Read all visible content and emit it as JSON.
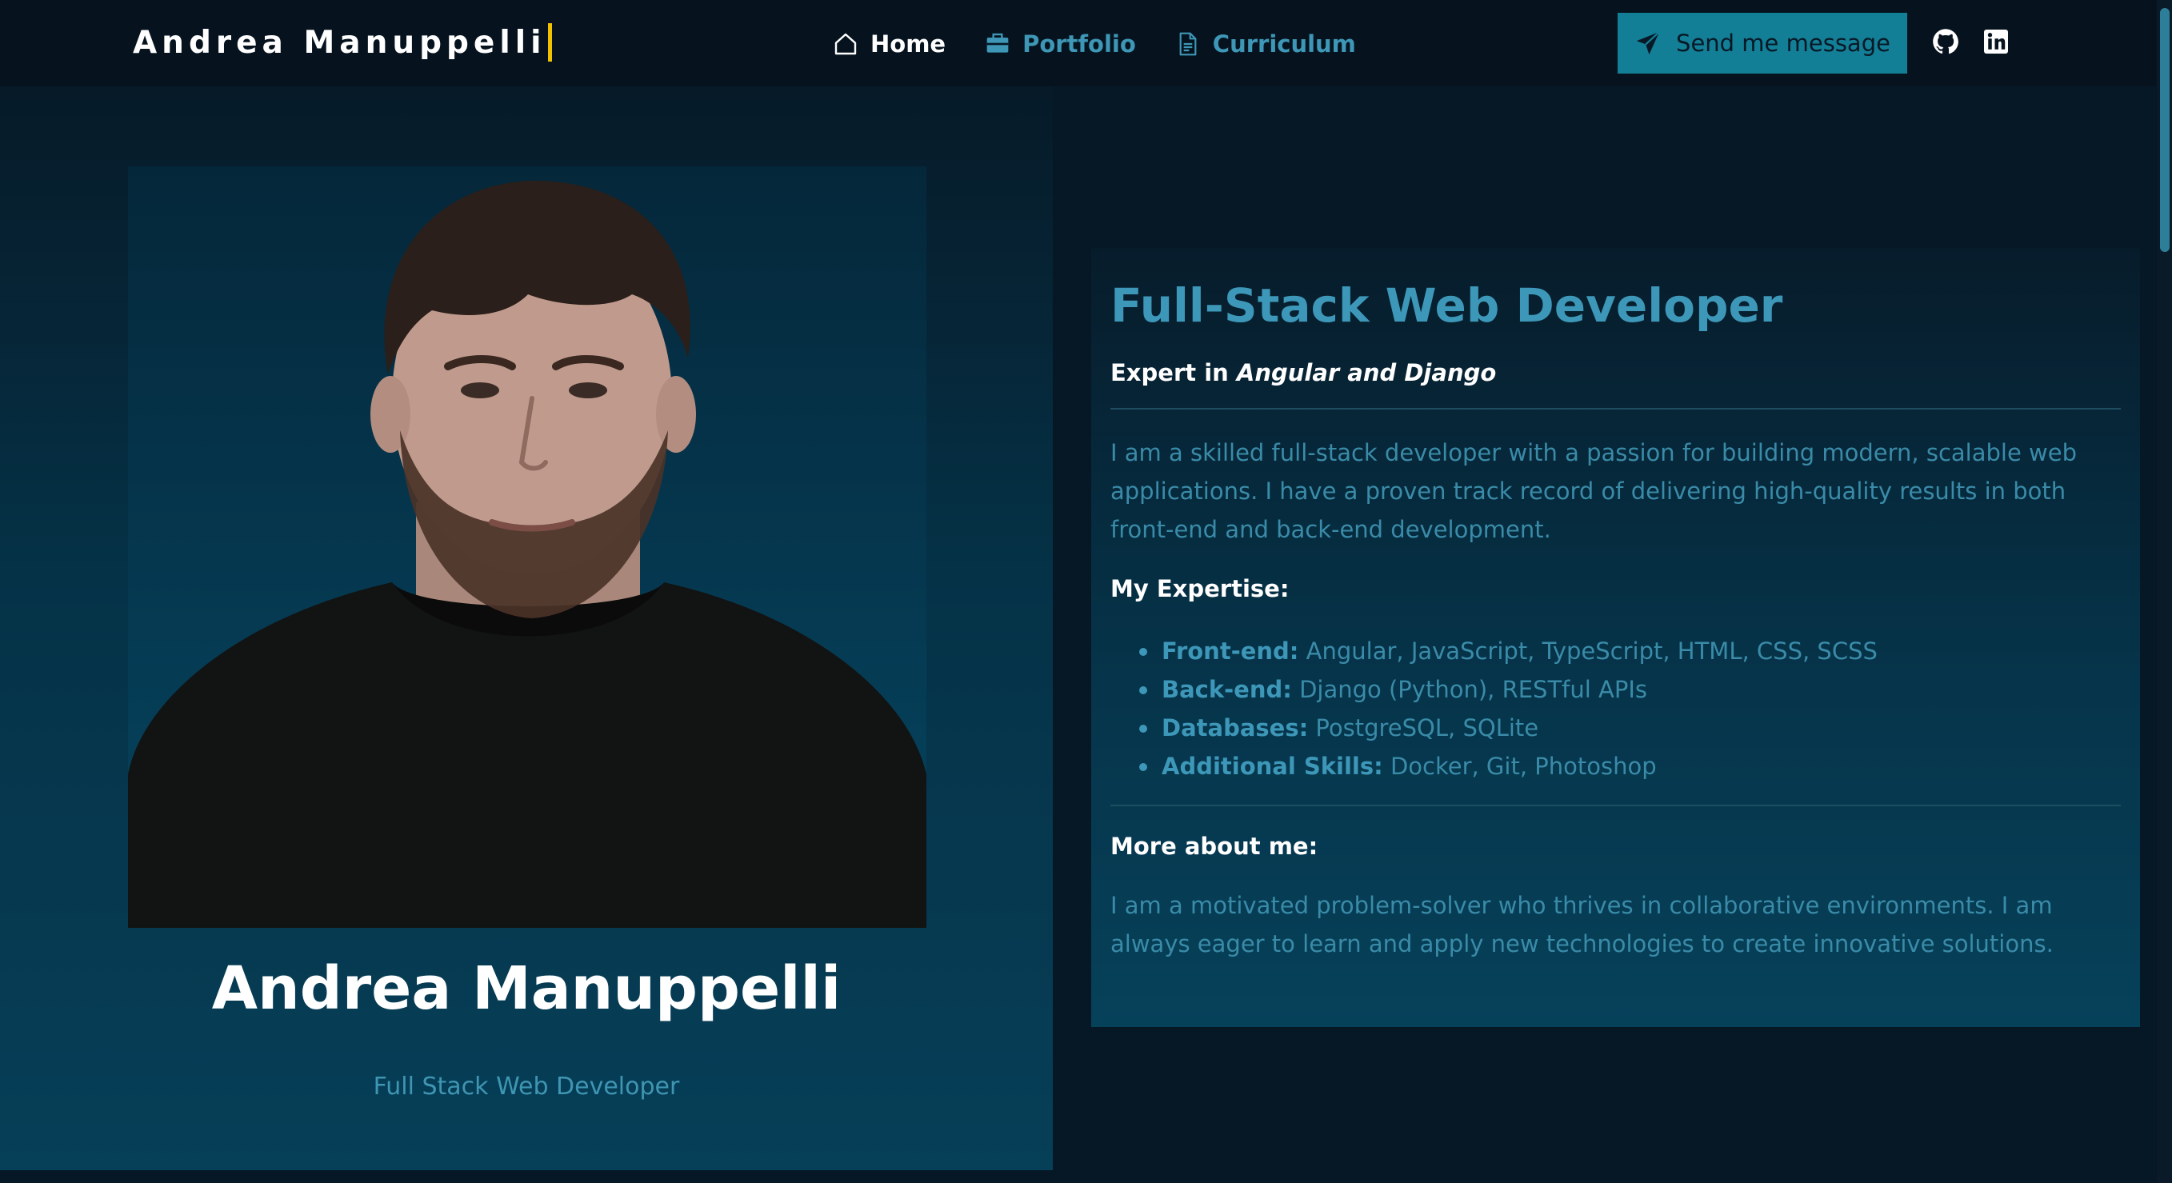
{
  "navbar": {
    "brand": "Andrea Manuppelli",
    "links": [
      {
        "label": "Home",
        "icon": "home-icon",
        "active": true
      },
      {
        "label": "Portfolio",
        "icon": "briefcase-icon",
        "active": false
      },
      {
        "label": "Curriculum",
        "icon": "document-icon",
        "active": false
      }
    ],
    "send_button": {
      "label": "Send me message",
      "icon": "paper-plane-icon"
    },
    "social": [
      {
        "icon": "github-icon"
      },
      {
        "icon": "linkedin-icon"
      }
    ]
  },
  "profile": {
    "name": "Andrea Manuppelli",
    "role": "Full Stack Web Developer",
    "photo": "profile-photo"
  },
  "card": {
    "title": "Full-Stack Web Developer",
    "subtitle_prefix": "Expert in ",
    "subtitle_em": "Angular and Django",
    "intro": "I am a skilled full-stack developer with a passion for building modern, scalable web applications. I have a proven track record of delivering high-quality results in both front-end and back-end development.",
    "expertise_heading": "My Expertise:",
    "skills": [
      {
        "label": "Front-end:",
        "value": " Angular, JavaScript, TypeScript, HTML, CSS, SCSS"
      },
      {
        "label": "Back-end:",
        "value": " Django (Python), RESTful APIs"
      },
      {
        "label": "Databases:",
        "value": " PostgreSQL, SQLite"
      },
      {
        "label": "Additional Skills:",
        "value": " Docker, Git, Photoshop"
      }
    ],
    "more_heading": "More about me:",
    "more_text": "I am a motivated problem-solver who thrives in collaborative environments. I am always eager to learn and apply new technologies to create innovative solutions."
  },
  "colors": {
    "background": "#061726",
    "accent": "#3d97b8",
    "button": "#137f96",
    "caret": "#f2c200"
  }
}
